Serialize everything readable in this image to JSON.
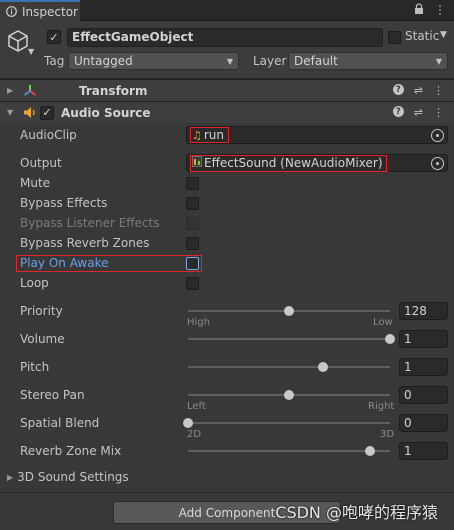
{
  "tab": {
    "title": "Inspector"
  },
  "gameobject": {
    "active": true,
    "name": "EffectGameObject",
    "static_label": "Static",
    "tag_label": "Tag",
    "tag_value": "Untagged",
    "layer_label": "Layer",
    "layer_value": "Default"
  },
  "components": {
    "transform": {
      "title": "Transform"
    },
    "audio_source": {
      "title": "Audio Source",
      "enabled": true
    }
  },
  "props": {
    "audioclip": {
      "label": "AudioClip",
      "value": "run"
    },
    "output": {
      "label": "Output",
      "value": "EffectSound (NewAudioMixer)"
    },
    "mute": {
      "label": "Mute"
    },
    "bypass_effects": {
      "label": "Bypass Effects"
    },
    "bypass_listener": {
      "label": "Bypass Listener Effects"
    },
    "bypass_reverb": {
      "label": "Bypass Reverb Zones"
    },
    "play_on_awake": {
      "label": "Play On Awake"
    },
    "loop": {
      "label": "Loop"
    },
    "priority": {
      "label": "Priority",
      "value": "128",
      "min_label": "High",
      "max_label": "Low",
      "fraction": 0.5
    },
    "volume": {
      "label": "Volume",
      "value": "1",
      "fraction": 1.0
    },
    "pitch": {
      "label": "Pitch",
      "value": "1",
      "fraction": 0.67
    },
    "stereo_pan": {
      "label": "Stereo Pan",
      "value": "0",
      "min_label": "Left",
      "max_label": "Right",
      "fraction": 0.5
    },
    "spatial_blend": {
      "label": "Spatial Blend",
      "value": "0",
      "min_label": "2D",
      "max_label": "3D",
      "fraction": 0.0
    },
    "reverb_mix": {
      "label": "Reverb Zone Mix",
      "value": "1",
      "fraction": 0.9
    }
  },
  "sections": {
    "sound3d": "3D Sound Settings"
  },
  "footer": {
    "add_component": "Add Component"
  },
  "watermark": "CSDN @咆哮的程序猿",
  "colors": {
    "accent": "#3a72b0",
    "highlight": "#e0262b",
    "audio_icon": "#e8a52c"
  }
}
